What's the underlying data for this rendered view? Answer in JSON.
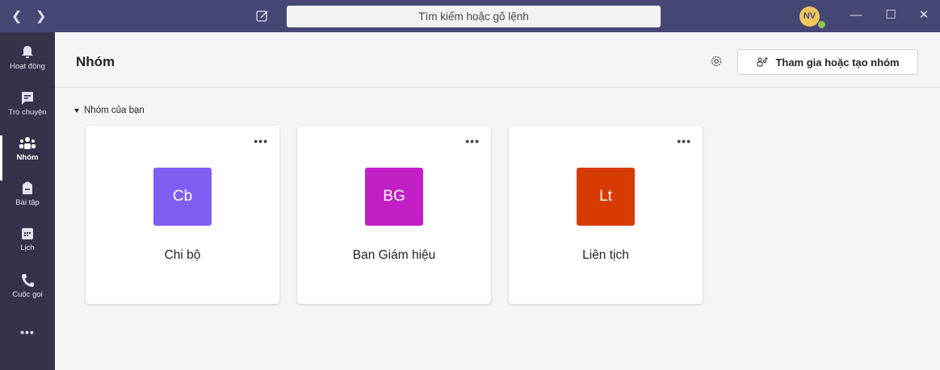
{
  "titlebar": {
    "back_icon": "chevron-left-icon",
    "forward_icon": "chevron-right-icon",
    "search_placeholder": "Tìm kiếm hoặc gõ lệnh",
    "avatar_initials": "NV",
    "presence_color": "#92c353"
  },
  "rail": {
    "items": [
      {
        "label": "Hoạt động",
        "icon": "bell-icon"
      },
      {
        "label": "Trò chuyện",
        "icon": "chat-icon"
      },
      {
        "label": "Nhóm",
        "icon": "teams-icon",
        "active": true
      },
      {
        "label": "Bài tập",
        "icon": "backpack-icon"
      },
      {
        "label": "Lịch",
        "icon": "calendar-icon"
      },
      {
        "label": "Cuộc gọi",
        "icon": "phone-icon"
      }
    ],
    "more_label": "•••"
  },
  "header": {
    "title": "Nhóm",
    "join_label": "Tham gia hoặc tạo nhóm"
  },
  "section": {
    "label": "Nhóm của bạn"
  },
  "teams": [
    {
      "initials": "Cb",
      "name": "Chi bộ",
      "color": "#7f5ff3"
    },
    {
      "initials": "BG",
      "name": "Ban Giám hiệu",
      "color": "#c31fc6"
    },
    {
      "initials": "Lt",
      "name": "Liên tịch",
      "color": "#d83b01"
    }
  ],
  "colors": {
    "titlebar": "#464775",
    "rail": "#33344a",
    "background": "#f5f5f5"
  }
}
